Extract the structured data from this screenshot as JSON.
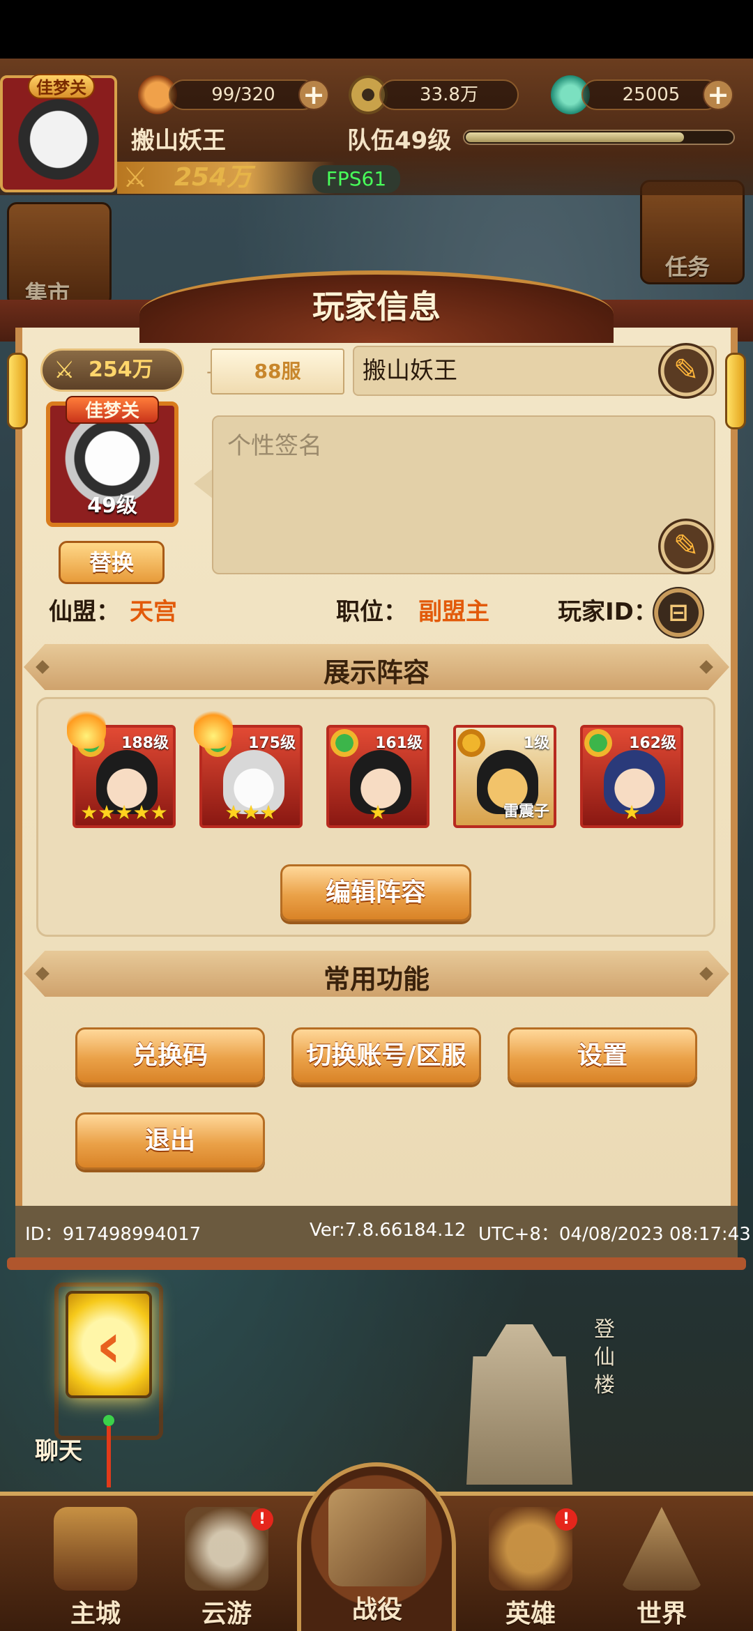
{
  "hud": {
    "avatar_tag": "佳梦关",
    "stamina": "99/320",
    "gold": "33.8万",
    "gems": "25005",
    "player_name": "搬山妖王",
    "team_level": "队伍49级",
    "team_exp_fraction": 0.82,
    "power": "254万",
    "fps": "FPS61"
  },
  "side_buttons": {
    "market": "集市",
    "quest": "任务"
  },
  "panel": {
    "title": "玩家信息",
    "power": "254万",
    "server": "88服",
    "name": "搬山妖王",
    "signature_placeholder": "个性签名",
    "portrait_tag": "佳梦关",
    "portrait_level": "49级",
    "swap_label": "替换",
    "alliance_label": "仙盟：",
    "alliance_value": "天宫",
    "position_label": "职位：",
    "position_value": "副盟主",
    "player_id_label": "玩家ID："
  },
  "lineup": {
    "title": "展示阵容",
    "heroes": [
      {
        "level": "188级",
        "stars": "★★★★★",
        "name": ""
      },
      {
        "level": "175级",
        "stars": "★★★",
        "name": ""
      },
      {
        "level": "161级",
        "stars": "★",
        "name": ""
      },
      {
        "level": "1级",
        "stars": "",
        "name": "雷震子"
      },
      {
        "level": "162级",
        "stars": "★",
        "name": ""
      }
    ],
    "edit_label": "编辑阵容"
  },
  "functions": {
    "title": "常用功能",
    "redeem": "兑换码",
    "switch_account": "切换账号/区服",
    "settings": "设置",
    "logout": "退出"
  },
  "footer": {
    "id": "ID：917498994017",
    "version": "Ver:7.8.66184.12",
    "time": "UTC+8：04/08/2023 08:17:43"
  },
  "map": {
    "chat": "聊天",
    "tower": "登仙楼"
  },
  "nav": {
    "main_city": "主城",
    "travel": "云游",
    "battle": "战役",
    "heroes": "英雄",
    "world": "世界",
    "badge": "!"
  },
  "colors": {
    "accent_orange": "#e25a0a",
    "fps_green": "#48ff5a",
    "panel_bg": "#f3e6c7"
  }
}
